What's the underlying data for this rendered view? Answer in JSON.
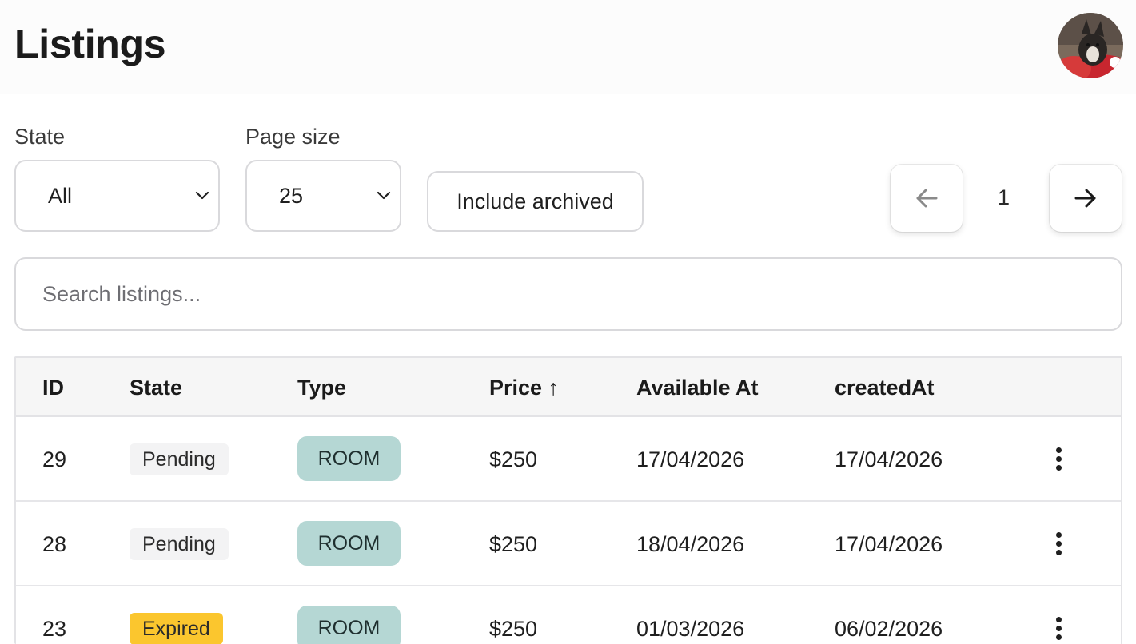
{
  "header": {
    "title": "Listings",
    "avatar_icon": "user-avatar-photo"
  },
  "filters": {
    "state_label": "State",
    "state_value": "All",
    "page_size_label": "Page size",
    "page_size_value": "25",
    "include_archived_label": "Include archived"
  },
  "pagination": {
    "prev_icon": "arrow-left-icon",
    "next_icon": "arrow-right-icon",
    "current_page": "1"
  },
  "search": {
    "placeholder": "Search listings..."
  },
  "table": {
    "columns": [
      "ID",
      "State",
      "Type",
      "Price ↑",
      "Available At",
      "createdAt"
    ],
    "rows": [
      {
        "id": "29",
        "state": "Pending",
        "type": "ROOM",
        "price": "$250",
        "available_at": "17/04/2026",
        "created_at": "17/04/2026"
      },
      {
        "id": "28",
        "state": "Pending",
        "type": "ROOM",
        "price": "$250",
        "available_at": "18/04/2026",
        "created_at": "17/04/2026"
      },
      {
        "id": "23",
        "state": "Expired",
        "type": "ROOM",
        "price": "$250",
        "available_at": "01/03/2026",
        "created_at": "06/02/2026"
      }
    ]
  },
  "colors": {
    "pending_badge": "#f3f3f4",
    "expired_badge": "#fbc62e",
    "type_badge": "#b5d7d4"
  }
}
